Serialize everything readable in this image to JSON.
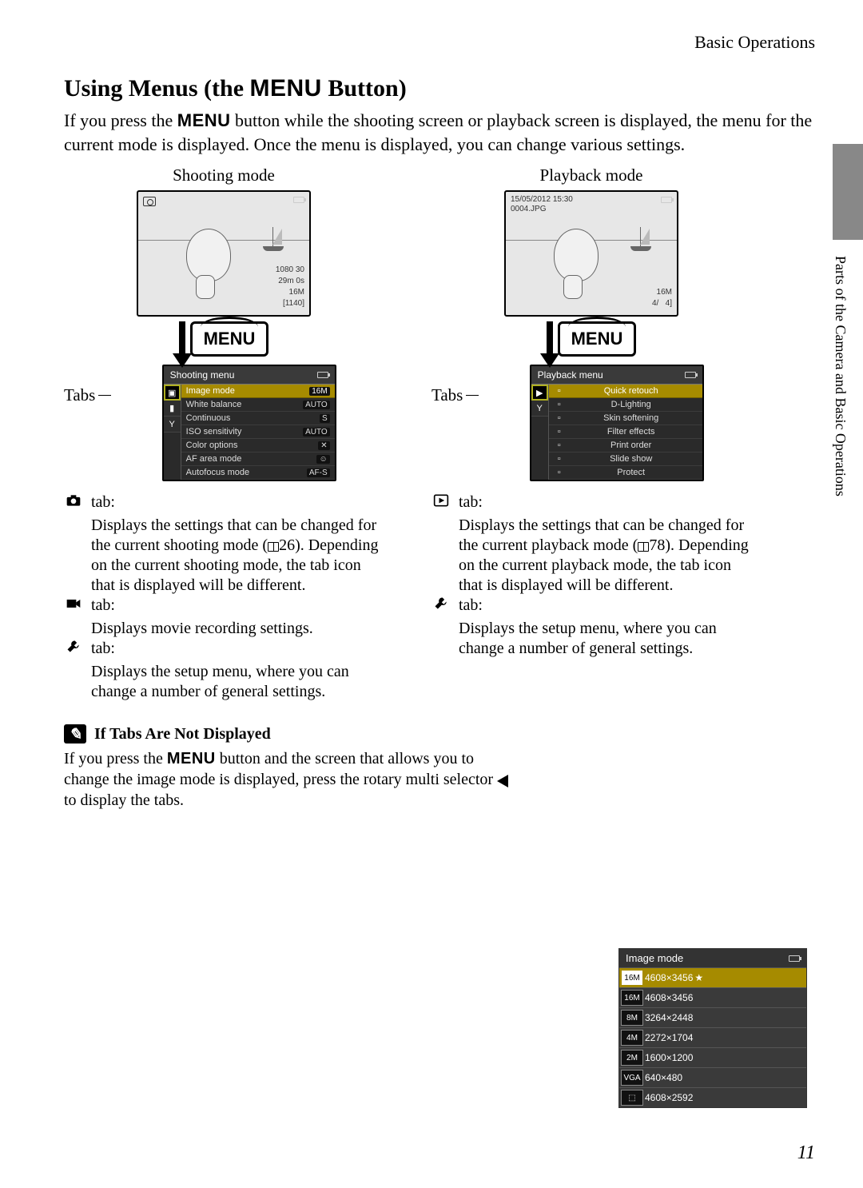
{
  "header": {
    "section": "Basic Operations"
  },
  "title": {
    "pre": "Using Menus (the ",
    "menu": "MENU",
    "post": " Button)"
  },
  "intro": {
    "p1a": "If you press the ",
    "menu": "MENU",
    "p1b": " button while the shooting screen or playback screen is displayed, the menu for the current mode is displayed. Once the menu is displayed, you can change various settings."
  },
  "side_label": "Parts of the Camera and Basic Operations",
  "menu_btn": "MENU",
  "tabs_label": "Tabs",
  "shooting": {
    "title": "Shooting mode",
    "osd": {
      "rec_quality": "1080 30",
      "time": "29m 0s",
      "size_badge": "16M",
      "remaining": "[1140]"
    },
    "panel_title": "Shooting menu",
    "items": [
      {
        "label": "Image mode",
        "value": "16M"
      },
      {
        "label": "White balance",
        "value": "AUTO"
      },
      {
        "label": "Continuous",
        "value": "S"
      },
      {
        "label": "ISO sensitivity",
        "value": "AUTO"
      },
      {
        "label": "Color options",
        "value": "✕"
      },
      {
        "label": "AF area mode",
        "value": "☺"
      },
      {
        "label": "Autofocus mode",
        "value": "AF-S"
      }
    ],
    "desc": {
      "t1_label": "tab:",
      "t1_a": "Displays the settings that can be changed for the current shooting mode (",
      "t1_ref": "26",
      "t1_b": "). Depending on the current shooting mode, the tab icon that is displayed will be different.",
      "t2_label": "tab:",
      "t2": "Displays movie recording settings.",
      "t3_label": "tab:",
      "t3": "Displays the setup menu, where you can change a number of general settings."
    }
  },
  "playback": {
    "title": "Playback mode",
    "osd": {
      "date": "15/05/2012 15:30",
      "file": "0004.JPG",
      "size_badge": "16M",
      "index": "4/",
      "total": "4]"
    },
    "panel_title": "Playback menu",
    "items": [
      {
        "label": "Quick retouch"
      },
      {
        "label": "D-Lighting"
      },
      {
        "label": "Skin softening"
      },
      {
        "label": "Filter effects"
      },
      {
        "label": "Print order"
      },
      {
        "label": "Slide show"
      },
      {
        "label": "Protect"
      }
    ],
    "desc": {
      "t1_label": "tab:",
      "t1_a": "Displays the settings that can be changed for the current playback mode (",
      "t1_ref": "78",
      "t1_b": "). Depending on the current playback mode, the tab icon that is displayed will be different.",
      "t2_label": "tab:",
      "t2": "Displays the setup menu, where you can change a number of general settings."
    }
  },
  "note": {
    "heading": "If Tabs Are Not Displayed",
    "a": "If you press the ",
    "menu": "MENU",
    "b": " button and the screen that allows you to change the image mode is displayed, press the rotary multi selector ",
    "c": " to display the tabs."
  },
  "image_mode": {
    "title": "Image mode",
    "rows": [
      {
        "badge": "16M",
        "res": "4608×3456",
        "star": true
      },
      {
        "badge": "16M",
        "res": "4608×3456"
      },
      {
        "badge": "8M",
        "res": "3264×2448"
      },
      {
        "badge": "4M",
        "res": "2272×1704"
      },
      {
        "badge": "2M",
        "res": "1600×1200"
      },
      {
        "badge": "VGA",
        "res": "640×480"
      },
      {
        "badge": "⬚",
        "res": "4608×2592"
      }
    ]
  },
  "page_number": "11"
}
